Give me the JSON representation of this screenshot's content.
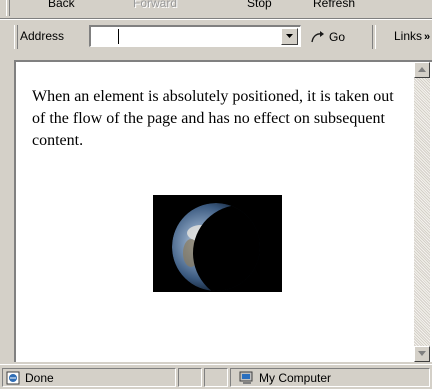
{
  "toolbar": {
    "back": "Back",
    "forward": "Forward",
    "stop": "Stop",
    "refresh": "Refresh"
  },
  "addressbar": {
    "label": "Address",
    "value": "",
    "go": "Go",
    "links": "Links",
    "links_chevron": "»"
  },
  "content": {
    "paragraph": "When an element is absolutely positioned, it is taken out of the flow of the page and has no effect on subsequent content.",
    "image_icon": "earth-image"
  },
  "status": {
    "text": "Done",
    "zone": "My Computer"
  },
  "colors": {
    "chrome": "#d4d0c8",
    "content_bg": "#ffffff",
    "disabled_text": "#9a9a9a"
  }
}
